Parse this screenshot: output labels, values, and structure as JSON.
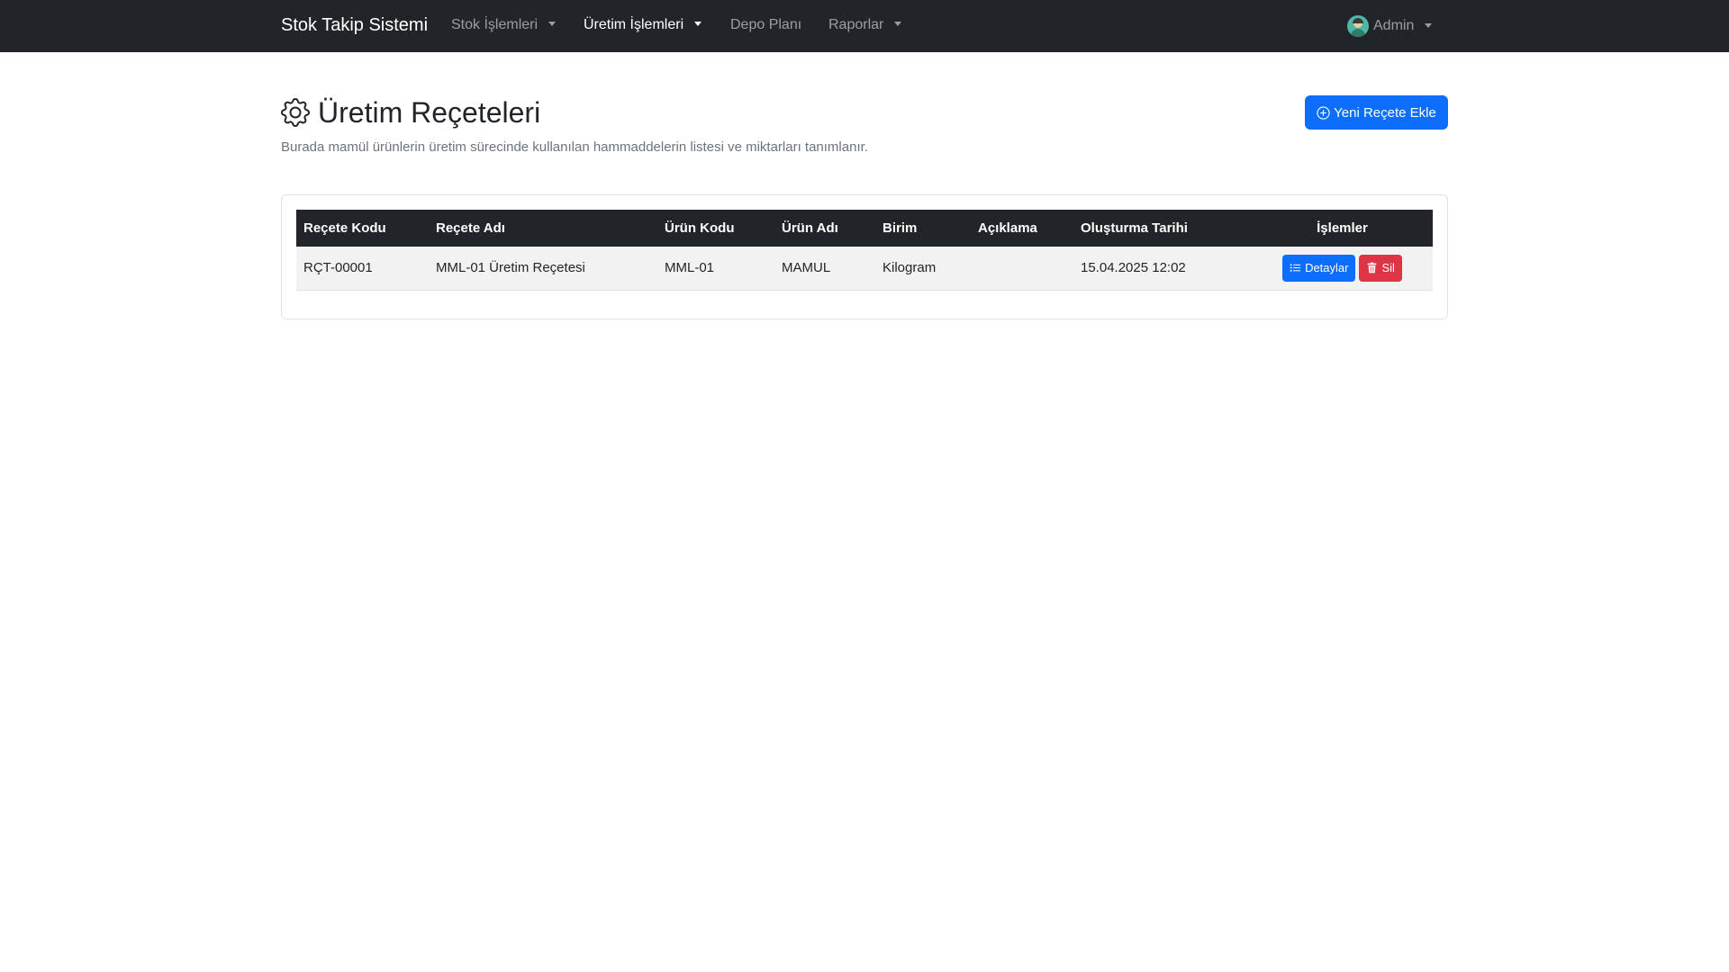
{
  "navbar": {
    "brand": "Stok Takip Sistemi",
    "items": [
      {
        "label": "Stok İşlemleri",
        "dropdown": true,
        "active": false
      },
      {
        "label": "Üretim İşlemleri",
        "dropdown": true,
        "active": true
      },
      {
        "label": "Depo Planı",
        "dropdown": false,
        "active": false
      },
      {
        "label": "Raporlar",
        "dropdown": true,
        "active": false
      }
    ],
    "user": {
      "name": "Admin",
      "icon": "avatar"
    }
  },
  "header": {
    "title": "Üretim Reçeteleri",
    "title_icon": "gear-icon",
    "subtitle": "Burada mamül ürünlerin üretim sürecinde kullanılan hammaddelerin listesi ve miktarları tanımlanır.",
    "add_button": "Yeni Reçete Ekle",
    "add_button_icon": "plus-circle-icon"
  },
  "table": {
    "columns": [
      "Reçete Kodu",
      "Reçete Adı",
      "Ürün Kodu",
      "Ürün Adı",
      "Birim",
      "Açıklama",
      "Oluşturma Tarihi",
      "İşlemler"
    ],
    "rows": [
      {
        "recete_kodu": "RÇT-00001",
        "recete_adi": "MML-01 Üretim Reçetesi",
        "urun_kodu": "MML-01",
        "urun_adi": "MAMUL",
        "birim": "Kilogram",
        "aciklama": "",
        "olusturma_tarihi": "15.04.2025 12:02",
        "details_label": "Detaylar",
        "delete_label": "Sil"
      }
    ]
  },
  "colors": {
    "navbar_bg": "#212529",
    "primary": "#0d6efd",
    "danger": "#dc3545"
  }
}
